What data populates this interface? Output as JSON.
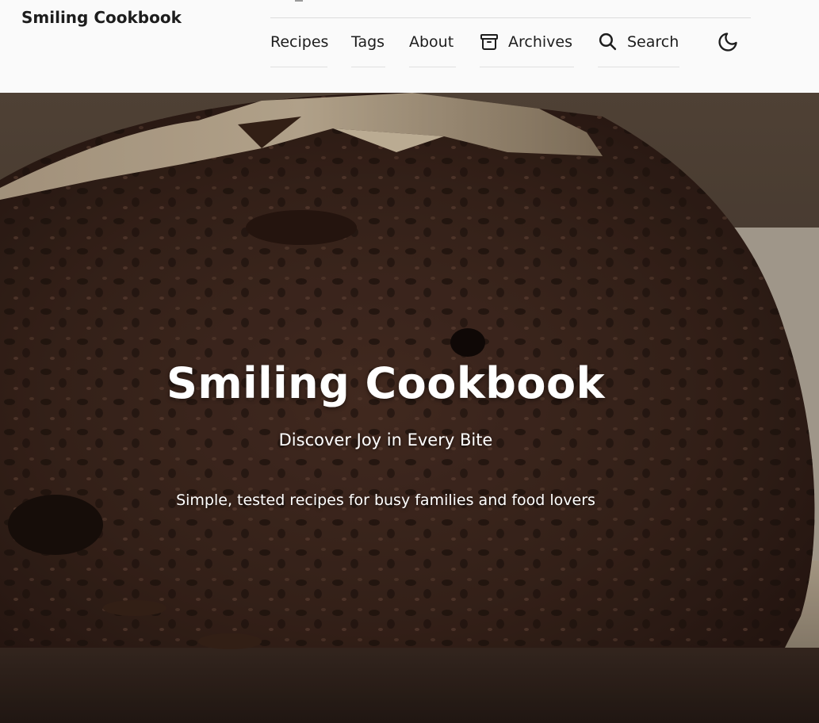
{
  "header": {
    "site_title": "Smiling Cookbook",
    "nav": [
      {
        "label": "Recipes",
        "icon": ""
      },
      {
        "label": "Tags",
        "icon": ""
      },
      {
        "label": "About",
        "icon": ""
      },
      {
        "label": "Archives",
        "icon": "archive-icon"
      },
      {
        "label": "Search",
        "icon": "search-icon"
      }
    ],
    "theme_toggle_icon": "moon-icon"
  },
  "hero": {
    "title": "Smiling Cookbook",
    "subtitle": "Discover Joy in Every Bite",
    "tagline": "Simple, tested recipes for busy families and food lovers",
    "background_image": "bread-loaf-photo"
  },
  "colors": {
    "text": "#1d1d1d",
    "header_bg": "#fafafa",
    "hero_text": "#ffffff"
  }
}
